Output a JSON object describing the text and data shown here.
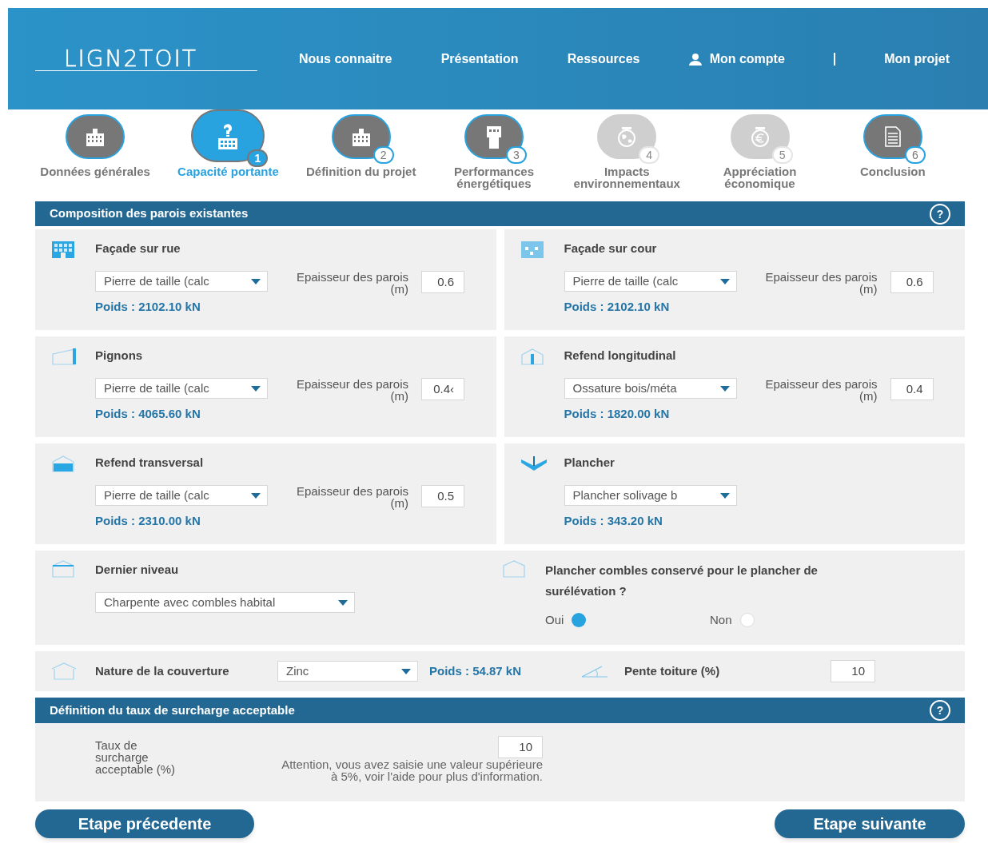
{
  "header": {
    "logo": "LIGN2TOIT",
    "nav": [
      {
        "label": "Nous connaitre",
        "kind": "link"
      },
      {
        "label": "Présentation",
        "kind": "link"
      },
      {
        "label": "Ressources",
        "kind": "link"
      },
      {
        "label": "Mon compte",
        "kind": "account"
      },
      {
        "label": "Mon projet",
        "kind": "link"
      }
    ]
  },
  "steps": [
    {
      "label": "Données générales",
      "selected": false,
      "disabled": false,
      "kind": "building"
    },
    {
      "label": "Capacité portante",
      "number": "1",
      "selected": true,
      "disabled": false,
      "kind": "question"
    },
    {
      "label": "Définition du projet",
      "number": "2",
      "selected": false,
      "disabled": false,
      "kind": "building"
    },
    {
      "label": "Performances énergétiques",
      "number": "3",
      "selected": false,
      "disabled": false,
      "kind": "tower"
    },
    {
      "label": "Impacts environnementaux",
      "number": "4",
      "selected": false,
      "disabled": true,
      "kind": "globe"
    },
    {
      "label": "Appréciation économique",
      "number": "5",
      "selected": false,
      "disabled": true,
      "kind": "euro"
    },
    {
      "label": "Conclusion",
      "number": "6",
      "selected": false,
      "disabled": false,
      "kind": "document"
    }
  ],
  "section1": {
    "title": "Composition des parois existantes",
    "help": "?"
  },
  "walls": [
    {
      "kind": "facade",
      "title": "Façade sur rue",
      "material": "Pierre de taille (calc",
      "thickness_label": "Epaisseur des parois (m)",
      "thickness": "0.6",
      "weight": "Poids : 2102.10 kN"
    },
    {
      "kind": "courtyard",
      "title": "Façade sur cour",
      "material": "Pierre de taille (calc",
      "thickness_label": "Epaisseur des parois (m)",
      "thickness": "0.6",
      "weight": "Poids : 2102.10 kN"
    },
    {
      "kind": "gable",
      "title": "Pignons",
      "material": "Pierre de taille (calc",
      "thickness_label": "Epaisseur des parois (m)",
      "thickness": "0.4‹",
      "weight": "Poids : 4065.60 kN"
    },
    {
      "kind": "longitudinal",
      "title": "Refend longitudinal",
      "material": "Ossature bois/méta",
      "thickness_label": "Epaisseur des parois (m)",
      "thickness": "0.4",
      "weight": "Poids : 1820.00 kN"
    },
    {
      "kind": "transversal",
      "title": "Refend transversal",
      "material": "Pierre de taille (calc",
      "thickness_label": "Epaisseur des parois (m)",
      "thickness": "0.5",
      "weight": "Poids : 2310.00 kN"
    },
    {
      "kind": "floor",
      "title": "Plancher",
      "material": "Plancher solivage b",
      "weight": "Poids : 343.20 kN"
    }
  ],
  "top_level": {
    "title": "Dernier niveau",
    "value": "Charpente avec combles habital",
    "question": "Plancher combles conservé pour le plancher de surélévation ?",
    "options": [
      {
        "label": "Oui",
        "selected": true
      },
      {
        "label": "Non",
        "selected": false
      }
    ]
  },
  "roofing": {
    "label": "Nature de la couverture",
    "value": "Zinc",
    "weight": "Poids : 54.87 kN",
    "slope_label": "Pente toiture (%)",
    "slope": "10"
  },
  "section2": {
    "title": "Définition du taux de surcharge acceptable",
    "help": "?",
    "rate_label": "Taux de surcharge acceptable (%)",
    "rate": "10",
    "warning": "Attention, vous avez saisie une valeur supérieure à 5%, voir l'aide pour plus d'information."
  },
  "buttons": {
    "previous": "Etape précedente",
    "next": "Etape suivante"
  }
}
